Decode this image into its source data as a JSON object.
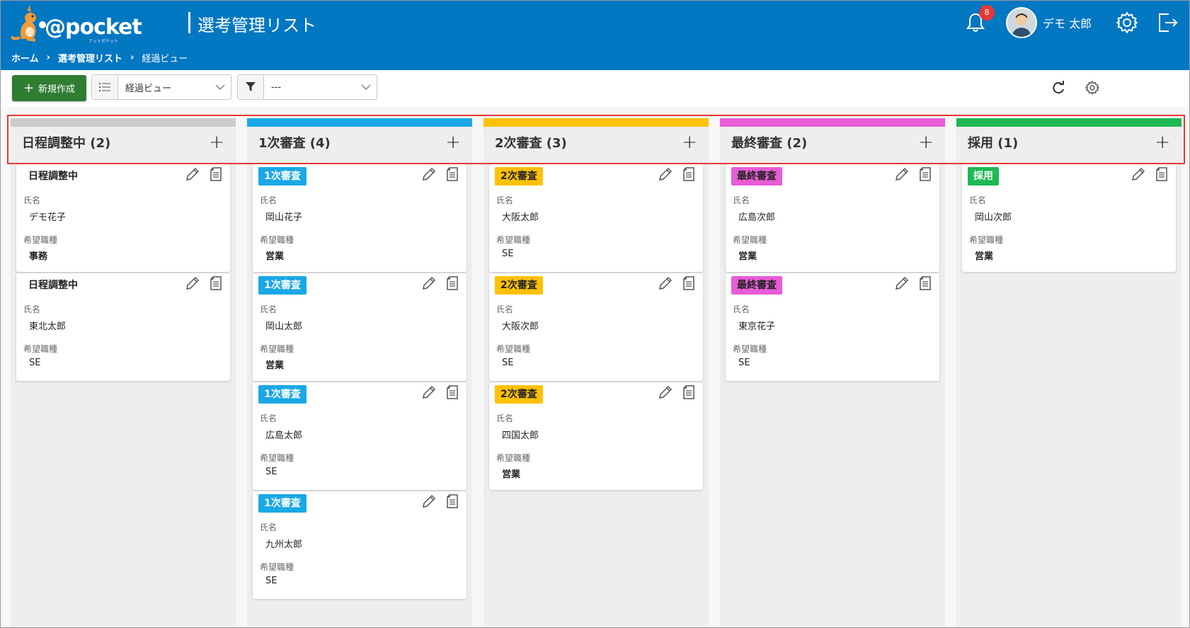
{
  "header": {
    "logo_text": "@pocket",
    "logo_sub": "アットポケット",
    "app_title": "選考管理リスト",
    "notification_count": "8",
    "user_name": "デモ 太郎"
  },
  "breadcrumb": {
    "home": "ホーム",
    "list": "選考管理リスト",
    "current": "経過ビュー",
    "separator": "›"
  },
  "toolbar": {
    "new_label": "新規作成",
    "view_select": "経過ビュー",
    "filter_select": "---"
  },
  "labels": {
    "name": "氏名",
    "job": "希望職種"
  },
  "columns": [
    {
      "title": "日程調整中 (2)",
      "color": "#cccccc"
    },
    {
      "title": "1次審査 (4)",
      "color": "#1aa8e6"
    },
    {
      "title": "2次審査 (3)",
      "color": "#ffc107"
    },
    {
      "title": "最終審査 (2)",
      "color": "#e85cd6"
    },
    {
      "title": "採用 (1)",
      "color": "#1db954"
    }
  ],
  "cards": {
    "c0": [
      {
        "status": "日程調整中",
        "name": "デモ花子",
        "job": "事務"
      },
      {
        "status": "日程調整中",
        "name": "東北太郎",
        "job": "SE"
      }
    ],
    "c1": [
      {
        "status": "1次審査",
        "name": "岡山花子",
        "job": "営業"
      },
      {
        "status": "1次審査",
        "name": "岡山太郎",
        "job": "営業"
      },
      {
        "status": "1次審査",
        "name": "広島太郎",
        "job": "SE"
      },
      {
        "status": "1次審査",
        "name": "九州太郎",
        "job": "SE"
      }
    ],
    "c2": [
      {
        "status": "2次審査",
        "name": "大阪太郎",
        "job": "SE"
      },
      {
        "status": "2次審査",
        "name": "大阪次郎",
        "job": "SE"
      },
      {
        "status": "2次審査",
        "name": "四国太郎",
        "job": "営業"
      }
    ],
    "c3": [
      {
        "status": "最終審査",
        "name": "広島次郎",
        "job": "営業"
      },
      {
        "status": "最終審査",
        "name": "東京花子",
        "job": "SE"
      }
    ],
    "c4": [
      {
        "status": "採用",
        "name": "岡山次郎",
        "job": "営業"
      }
    ]
  },
  "colors": {
    "header_blue": "#0277c2",
    "new_button_green": "#2e7d32",
    "highlight_red": "#e53935"
  }
}
